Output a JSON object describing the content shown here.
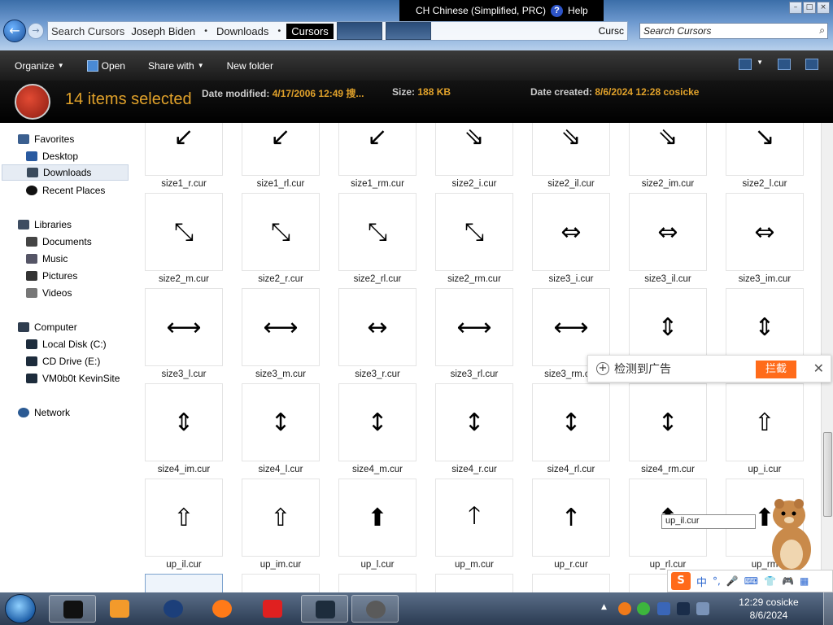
{
  "window": {
    "breadcrumbs": [
      "Joseph Biden",
      "Downloads",
      "Cursors"
    ],
    "address_overlay": "Search Cursors",
    "address_tail": "Cursc",
    "search_placeholder": "Search Cursors",
    "lang_bar": "CH Chinese (Simplified, PRC)",
    "help_label": "Help"
  },
  "toolbar": {
    "organize": "Organize",
    "open": "Open",
    "share_with": "Share with",
    "new_folder": "New folder"
  },
  "details": {
    "selection": "14 items selected",
    "date_modified_label": "Date modified:",
    "date_modified_value": "4/17/2006 12:49 搜...",
    "size_label": "Size:",
    "size_value": "188 KB",
    "date_created_label": "Date created:",
    "date_created_value": "8/6/2024 12:28 cosicke"
  },
  "nav": {
    "favorites": "Favorites",
    "desktop": "Desktop",
    "downloads": "Downloads",
    "recent_places": "Recent Places",
    "libraries": "Libraries",
    "documents": "Documents",
    "music": "Music",
    "pictures": "Pictures",
    "videos": "Videos",
    "computer": "Computer",
    "local_disk": "Local Disk (C:)",
    "cd_drive": "CD Drive (E:)",
    "network_drive": "VM0b0t KevinSite",
    "network": "Network"
  },
  "files": [
    {
      "name": "size1_r.cur",
      "glyph": "↙"
    },
    {
      "name": "size1_rl.cur",
      "glyph": "↙"
    },
    {
      "name": "size1_rm.cur",
      "glyph": "↙"
    },
    {
      "name": "size2_i.cur",
      "glyph": "⇘"
    },
    {
      "name": "size2_il.cur",
      "glyph": "⇘"
    },
    {
      "name": "size2_im.cur",
      "glyph": "⇘"
    },
    {
      "name": "size2_l.cur",
      "glyph": "↘"
    },
    {
      "name": "size2_m.cur",
      "glyph": "⤡"
    },
    {
      "name": "size2_r.cur",
      "glyph": "⤡"
    },
    {
      "name": "size2_rl.cur",
      "glyph": "⤡"
    },
    {
      "name": "size2_rm.cur",
      "glyph": "⤡"
    },
    {
      "name": "size3_i.cur",
      "glyph": "⇔"
    },
    {
      "name": "size3_il.cur",
      "glyph": "⇔"
    },
    {
      "name": "size3_im.cur",
      "glyph": "⇔"
    },
    {
      "name": "size3_l.cur",
      "glyph": "⟷"
    },
    {
      "name": "size3_m.cur",
      "glyph": "⟷"
    },
    {
      "name": "size3_r.cur",
      "glyph": "↔"
    },
    {
      "name": "size3_rl.cur",
      "glyph": "⟷"
    },
    {
      "name": "size3_rm.cur",
      "glyph": "⟷"
    },
    {
      "name": "",
      "glyph": "⇕"
    },
    {
      "name": "",
      "glyph": "⇕"
    },
    {
      "name": "size4_im.cur",
      "glyph": "⇕"
    },
    {
      "name": "size4_l.cur",
      "glyph": "↕"
    },
    {
      "name": "size4_m.cur",
      "glyph": "↕"
    },
    {
      "name": "size4_r.cur",
      "glyph": "↕"
    },
    {
      "name": "size4_rl.cur",
      "glyph": "↕"
    },
    {
      "name": "size4_rm.cur",
      "glyph": "↕"
    },
    {
      "name": "up_i.cur",
      "glyph": "⇧"
    },
    {
      "name": "up_il.cur",
      "glyph": "⇧"
    },
    {
      "name": "up_im.cur",
      "glyph": "⇧"
    },
    {
      "name": "up_l.cur",
      "glyph": "⬆"
    },
    {
      "name": "up_m.cur",
      "glyph": "🡑"
    },
    {
      "name": "up_r.cur",
      "glyph": "↑"
    },
    {
      "name": "up_rl.cur",
      "glyph": "⬆"
    },
    {
      "name": "up_rm",
      "glyph": "⬆"
    },
    {
      "name": "",
      "glyph": "◣"
    },
    {
      "name": "",
      "glyph": "⌛"
    },
    {
      "name": "",
      "glyph": "⌛"
    },
    {
      "name": "",
      "glyph": "⌛"
    },
    {
      "name": "",
      "glyph": "⌛"
    },
    {
      "name": "",
      "glyph": "⌛"
    },
    {
      "name": "",
      "glyph": "⌛"
    }
  ],
  "ad": {
    "text": "检测到广告",
    "block_label": "拦截"
  },
  "tooltip": "up_il.cur",
  "ime": {
    "logo": "S",
    "mode": "中"
  },
  "taskbar": {
    "time": "12:29 cosicke",
    "date": "8/6/2024"
  }
}
